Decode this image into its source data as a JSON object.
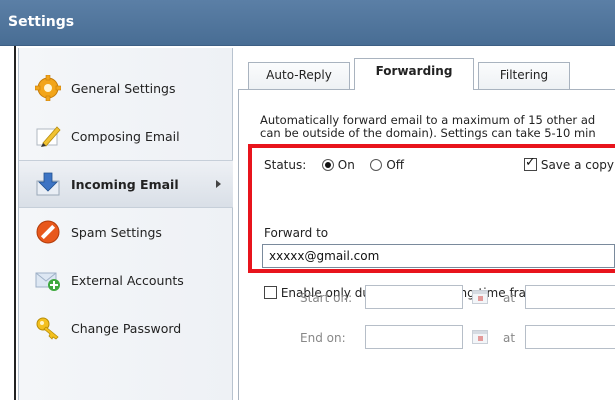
{
  "window": {
    "title": "Settings"
  },
  "sidebar": {
    "items": [
      {
        "label": "General Settings",
        "icon": "gear-icon"
      },
      {
        "label": "Composing Email",
        "icon": "pencil-icon"
      },
      {
        "label": "Incoming Email",
        "icon": "down-arrow-icon",
        "active": true
      },
      {
        "label": "Spam Settings",
        "icon": "no-entry-icon"
      },
      {
        "label": "External Accounts",
        "icon": "add-account-icon"
      },
      {
        "label": "Change Password",
        "icon": "key-icon"
      }
    ]
  },
  "tabs": [
    {
      "label": "Auto-Reply"
    },
    {
      "label": "Forwarding",
      "active": true
    },
    {
      "label": "Filtering"
    }
  ],
  "forwarding": {
    "description_line1": "Automatically forward email to a maximum of 15 other ad",
    "description_line2": "can be outside of the domain). Settings can take 5-10 min",
    "status_label": "Status:",
    "status_on": "On",
    "status_off": "Off",
    "save_copy_label": "Save a copy",
    "forward_to_label": "Forward to",
    "forward_to_value": "xxxxx@gmail.com",
    "enable_timeframe_label": "Enable only during the following time frame",
    "start_on_label": "Start on:",
    "end_on_label": "End on:",
    "at_label": "at"
  },
  "colors": {
    "titlebar": "#5b7fa6",
    "highlight_box": "#e8141c"
  }
}
